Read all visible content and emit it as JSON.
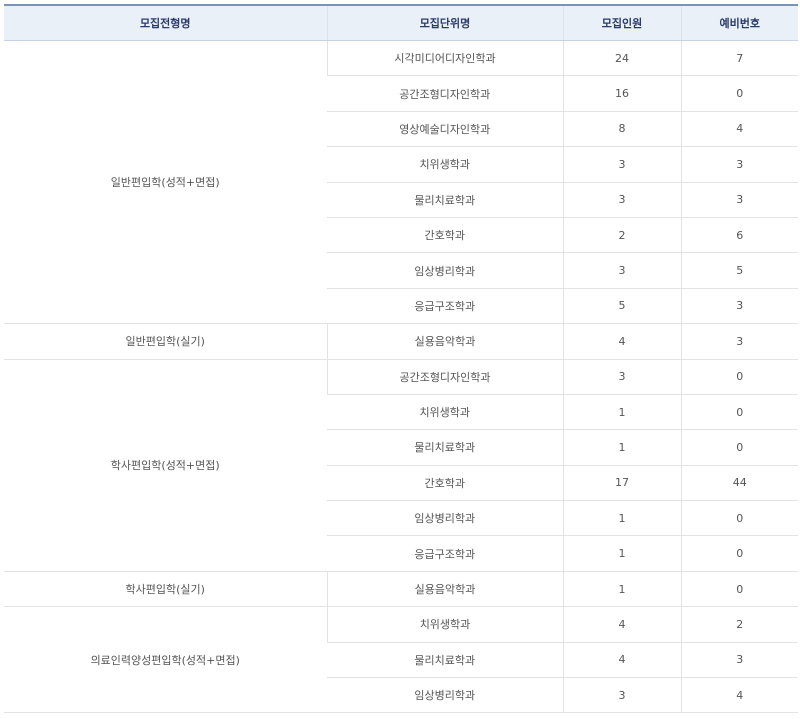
{
  "headers": [
    "모집전형명",
    "모집단위명",
    "모집인원",
    "예비번호"
  ],
  "groups": [
    {
      "name": "일반편입학(성적+면접)",
      "rows": [
        {
          "unit": "시각미디어디자인학과",
          "count": "24",
          "reserve": "7"
        },
        {
          "unit": "공간조형디자인학과",
          "count": "16",
          "reserve": "0"
        },
        {
          "unit": "영상예술디자인학과",
          "count": "8",
          "reserve": "4"
        },
        {
          "unit": "치위생학과",
          "count": "3",
          "reserve": "3"
        },
        {
          "unit": "물리치료학과",
          "count": "3",
          "reserve": "3"
        },
        {
          "unit": "간호학과",
          "count": "2",
          "reserve": "6"
        },
        {
          "unit": "임상병리학과",
          "count": "3",
          "reserve": "5"
        },
        {
          "unit": "응급구조학과",
          "count": "5",
          "reserve": "3"
        }
      ]
    },
    {
      "name": "일반편입학(실기)",
      "rows": [
        {
          "unit": "실용음악학과",
          "count": "4",
          "reserve": "3"
        }
      ]
    },
    {
      "name": "학사편입학(성적+면접)",
      "rows": [
        {
          "unit": "공간조형디자인학과",
          "count": "3",
          "reserve": "0"
        },
        {
          "unit": "치위생학과",
          "count": "1",
          "reserve": "0"
        },
        {
          "unit": "물리치료학과",
          "count": "1",
          "reserve": "0"
        },
        {
          "unit": "간호학과",
          "count": "17",
          "reserve": "44"
        },
        {
          "unit": "임상병리학과",
          "count": "1",
          "reserve": "0"
        },
        {
          "unit": "응급구조학과",
          "count": "1",
          "reserve": "0"
        }
      ]
    },
    {
      "name": "학사편입학(실기)",
      "rows": [
        {
          "unit": "실용음악학과",
          "count": "1",
          "reserve": "0"
        }
      ]
    },
    {
      "name": "의료인력양성편입학(성적+면접)",
      "rows": [
        {
          "unit": "치위생학과",
          "count": "4",
          "reserve": "2"
        },
        {
          "unit": "물리치료학과",
          "count": "4",
          "reserve": "3"
        },
        {
          "unit": "임상병리학과",
          "count": "3",
          "reserve": "4"
        }
      ]
    }
  ]
}
